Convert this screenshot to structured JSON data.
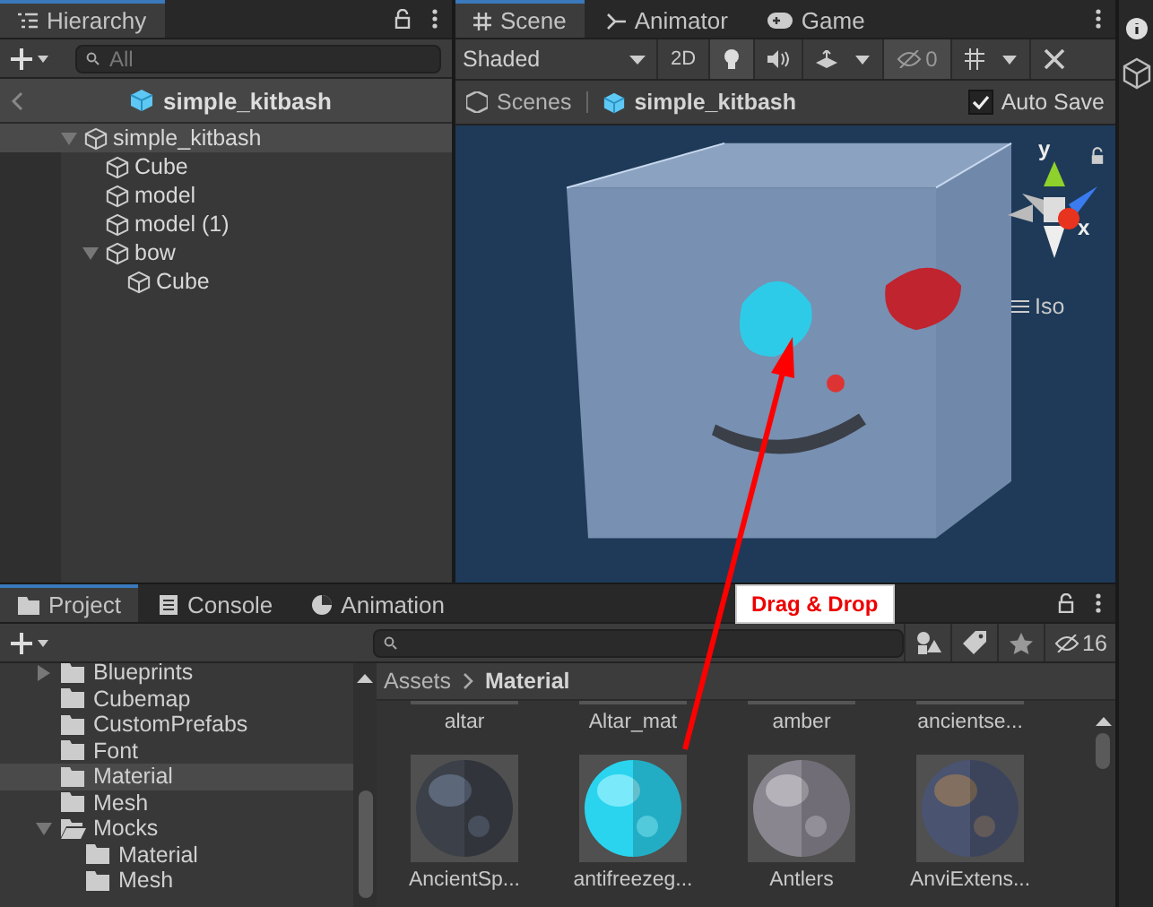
{
  "hierarchy": {
    "tab": "Hierarchy",
    "search": {
      "placeholder": "All"
    },
    "prefab_title": "simple_kitbash",
    "tree": [
      {
        "label": "simple_kitbash",
        "expanded": true,
        "selected": true,
        "children": [
          {
            "label": "Cube",
            "selected": false
          },
          {
            "label": "model",
            "selected": false
          },
          {
            "label": "model (1)",
            "selected": false
          },
          {
            "label": "bow",
            "expanded": true,
            "selected": false,
            "children": [
              {
                "label": "Cube",
                "selected": false
              }
            ]
          }
        ]
      }
    ]
  },
  "scene": {
    "tabs": [
      {
        "label": "Scene",
        "selected": true
      },
      {
        "label": "Animator",
        "selected": false
      },
      {
        "label": "Game",
        "selected": false
      }
    ],
    "toolbar": {
      "shading": "Shaded",
      "mode_2d": "2D",
      "hidden_count": "0",
      "lighting_on": true,
      "audio_on": false,
      "effects_on": false,
      "hidden_on": true,
      "grid_on": false
    },
    "breadcrumb": {
      "root": "Scenes",
      "current": "simple_kitbash"
    },
    "auto_save": {
      "label": "Auto Save",
      "checked": true
    },
    "gizmo": {
      "y": "y",
      "x": "x",
      "projection": "Iso"
    }
  },
  "callout": "Drag & Drop",
  "project": {
    "tabs": [
      {
        "label": "Project",
        "selected": true
      },
      {
        "label": "Console",
        "selected": false
      },
      {
        "label": "Animation",
        "selected": false
      }
    ],
    "hidden_count": "16",
    "folders": [
      {
        "label": "Blueprints",
        "selected": false,
        "expanded": false
      },
      {
        "label": "Cubemap",
        "selected": false
      },
      {
        "label": "CustomPrefabs",
        "selected": false
      },
      {
        "label": "Font",
        "selected": false
      },
      {
        "label": "Material",
        "selected": true
      },
      {
        "label": "Mesh",
        "selected": false
      },
      {
        "label": "Mocks",
        "selected": false,
        "expanded": true,
        "children": [
          {
            "label": "Material",
            "selected": false
          },
          {
            "label": "Mesh",
            "selected": false
          }
        ]
      }
    ],
    "breadcrumb": [
      "Assets",
      "Material"
    ],
    "assets_top": [
      "altar",
      "Altar_mat",
      "amber",
      "ancientse..."
    ],
    "assets": [
      {
        "label": "AncientSp...",
        "kind": "picture"
      },
      {
        "label": "antifreezeg...",
        "kind": "picture"
      },
      {
        "label": "Antlers",
        "kind": "picture"
      },
      {
        "label": "AnviExtens...",
        "kind": "picture"
      }
    ]
  }
}
